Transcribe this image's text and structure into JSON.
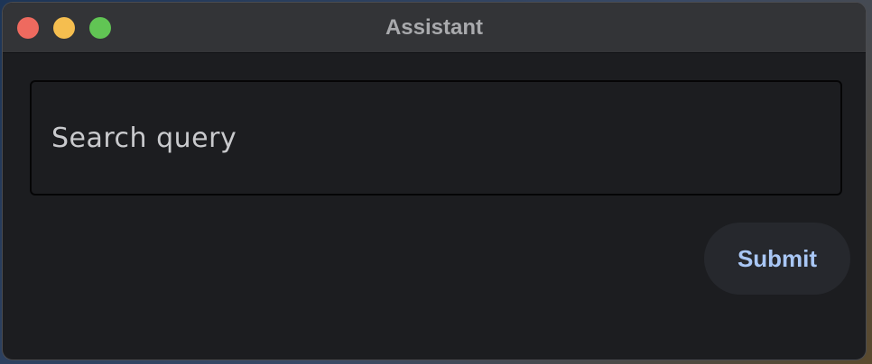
{
  "window": {
    "title": "Assistant"
  },
  "search": {
    "placeholder": "Search query",
    "value": ""
  },
  "actions": {
    "submit_label": "Submit"
  },
  "colors": {
    "close": "#ee6a5f",
    "minimize": "#f5be4f",
    "zoom": "#61c554",
    "accent": "#a9c7f5",
    "background": "#1c1d20"
  }
}
